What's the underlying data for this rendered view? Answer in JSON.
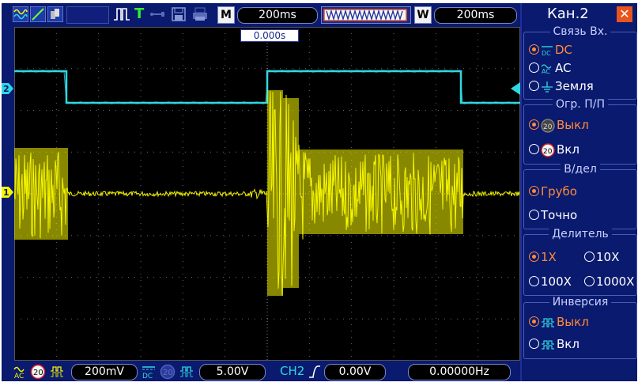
{
  "topbar": {
    "mode_badge": "M",
    "timebase": "200ms",
    "window_badge": "W",
    "window_timebase": "200ms",
    "trigger_letter": "T"
  },
  "plot": {
    "trigger_time": "0.000s",
    "ch1_marker": "1",
    "ch2_marker": "2"
  },
  "bottombar": {
    "ch1_coupling_icon": "ac-icon",
    "ch1_bw_label": "20",
    "ch1_volts": "200mV",
    "ch2_coupling_icon": "dc-icon",
    "ch2_bw_label": "20",
    "ch2_volts": "5.00V",
    "trig_source": "CH2",
    "trig_level": "0.00V",
    "frequency": "0.00000Hz"
  },
  "panel": {
    "title": "Кан.2",
    "coupling": {
      "label": "Связь  Вх.",
      "options": [
        {
          "label": "DC",
          "icon": "DC",
          "selected": true
        },
        {
          "label": "AC",
          "icon": "AC",
          "selected": false
        },
        {
          "label": "Земля",
          "icon": "ground",
          "selected": false
        }
      ]
    },
    "bw_limit": {
      "label": "Огр.  П/П",
      "options": [
        {
          "label": "Выкл",
          "icon": "20",
          "selected": true
        },
        {
          "label": "Вкл",
          "icon": "20",
          "selected": false
        }
      ]
    },
    "volts_div": {
      "label": "В/дел",
      "options": [
        {
          "label": "Грубо",
          "selected": true
        },
        {
          "label": "Точно",
          "selected": false
        }
      ]
    },
    "probe": {
      "label": "Делитель",
      "options": [
        {
          "label": "1X",
          "selected": true
        },
        {
          "label": "10X",
          "selected": false
        },
        {
          "label": "100X",
          "selected": false
        },
        {
          "label": "1000X",
          "selected": false
        }
      ]
    },
    "invert": {
      "label": "Инверсия",
      "options": [
        {
          "label": "Выкл",
          "selected": true
        },
        {
          "label": "Вкл",
          "selected": false
        }
      ]
    }
  },
  "colors": {
    "ch1": "#f5f500",
    "ch2": "#2fd8e0",
    "selected": "#ff8a3a",
    "background": "#0a1a6e"
  }
}
